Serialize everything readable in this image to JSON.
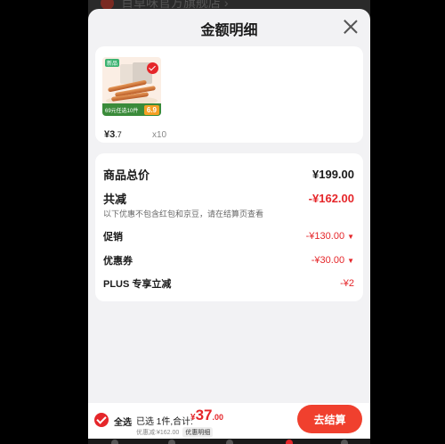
{
  "background": {
    "store_name": "百草味官方旗舰店 ›"
  },
  "sheet": {
    "title": "金额明细"
  },
  "product": {
    "image_tag": "新品",
    "promo_strip": "69元任选10件",
    "promo_price": "6.9",
    "unit_price_currency": "¥",
    "unit_price_int": "3",
    "unit_price_dec": ".7",
    "quantity": "x10"
  },
  "summary": {
    "total": {
      "label": "商品总价",
      "value": "¥199.00"
    },
    "discount": {
      "label": "共减",
      "value": "-¥162.00"
    },
    "note": "以下优惠不包含红包和京豆，请在结算页查看",
    "promotion": {
      "label": "促销",
      "value": "-¥130.00"
    },
    "coupon": {
      "label": "优惠券",
      "value": "-¥30.00"
    },
    "plus": {
      "label": "PLUS 专享立减",
      "value": "-¥2"
    }
  },
  "bottom_bar": {
    "select_all_label": "全选",
    "selected_text": "已选 1件,合计:",
    "total_currency": "¥",
    "total_int": "37",
    "total_dec": ".00",
    "discount_text": "优惠减:¥162.00",
    "detail_label": "优惠明细",
    "checkout_label": "去结算"
  },
  "colors": {
    "accent": "#e5262a",
    "checkout_button": "#f0402e",
    "sheet_bg": "#f2f2f4"
  }
}
